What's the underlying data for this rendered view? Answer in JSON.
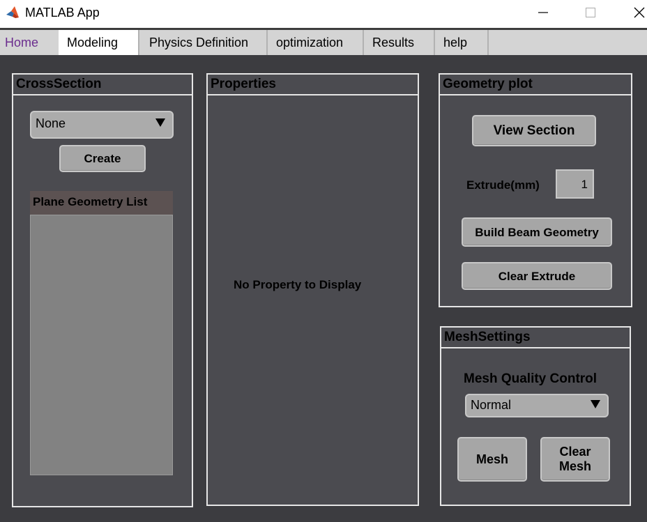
{
  "window": {
    "title": "MATLAB App",
    "icon": "matlab-logo-icon",
    "controls": [
      "minimize-icon",
      "maximize-icon",
      "close-icon"
    ]
  },
  "tabs": {
    "home": "Home",
    "modeling": "Modeling",
    "physics": "Physics Definition",
    "optimization": "optimization",
    "results": "Results",
    "help": "help",
    "active": "Modeling"
  },
  "cross_section": {
    "title": "CrossSection",
    "dropdown_value": "None",
    "create_label": "Create",
    "list_title": "Plane Geometry List",
    "list_items": []
  },
  "properties": {
    "title": "Properties",
    "empty_message": "No Property to Display"
  },
  "geometry_plot": {
    "title": "Geometry plot",
    "view_section_label": "View Section",
    "extrude_label": "Extrude(mm)",
    "extrude_value": "1",
    "build_beam_label": "Build Beam Geometry",
    "clear_extrude_label": "Clear Extrude"
  },
  "mesh_settings": {
    "title": "MeshSettings",
    "quality_label": "Mesh Quality Control",
    "quality_value": "Normal",
    "mesh_label": "Mesh",
    "clear_mesh_line1": "Clear",
    "clear_mesh_line2": "Mesh"
  },
  "colors": {
    "background": "#3c3c40",
    "panel": "#4b4b50",
    "button": "#a6a6a6",
    "home_tab": "#6b2d8e"
  }
}
